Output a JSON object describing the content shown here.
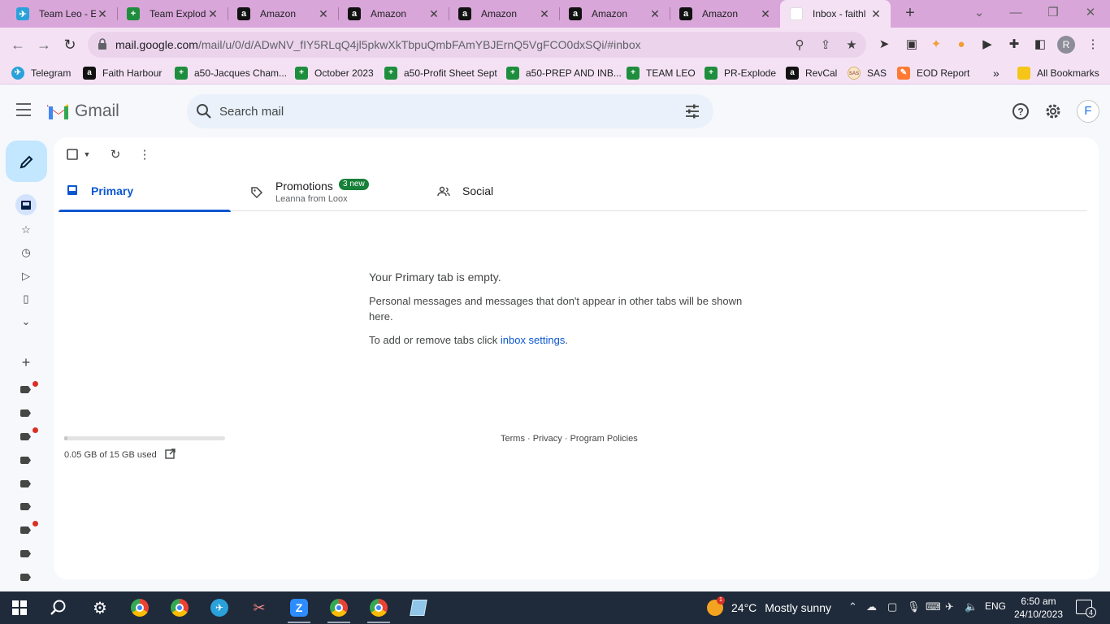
{
  "browser": {
    "tabs": [
      {
        "label": "Team Leo - E",
        "favicon": "telegram-icon"
      },
      {
        "label": "Team Explod",
        "favicon": "sheets-icon"
      },
      {
        "label": "Amazon",
        "favicon": "amazon-icon"
      },
      {
        "label": "Amazon",
        "favicon": "amazon-icon"
      },
      {
        "label": "Amazon",
        "favicon": "amazon-icon"
      },
      {
        "label": "Amazon",
        "favicon": "amazon-icon"
      },
      {
        "label": "Amazon",
        "favicon": "amazon-icon"
      },
      {
        "label": "Inbox - faithl",
        "favicon": "gmail-icon",
        "active": true
      }
    ],
    "url_host": "mail.google.com",
    "url_path": "/mail/u/0/d/ADwNV_fIY5RLqQ4jl5pkwXkTbpuQmbFAmYBJErnQ5VgFCO0dxSQi/#inbox",
    "profile_initial": "R",
    "bookmarks": [
      {
        "label": "Telegram",
        "icon": "telegram-icon"
      },
      {
        "label": "Faith Harbour",
        "icon": "amazon-icon"
      },
      {
        "label": "a50-Jacques Cham...",
        "icon": "sheets-icon"
      },
      {
        "label": "October 2023",
        "icon": "sheets-icon"
      },
      {
        "label": "a50-Profit Sheet Sept",
        "icon": "sheets-icon"
      },
      {
        "label": "a50-PREP AND INB...",
        "icon": "sheets-icon"
      },
      {
        "label": "TEAM LEO",
        "icon": "sheets-icon"
      },
      {
        "label": "PR-Explode",
        "icon": "sheets-icon"
      },
      {
        "label": "RevCal",
        "icon": "amazon-icon"
      },
      {
        "label": "SAS",
        "icon": "sas-icon"
      },
      {
        "label": "EOD Report",
        "icon": "eod-icon"
      }
    ],
    "more_bookmarks": "»",
    "all_bookmarks": "All Bookmarks",
    "colors": {
      "tabstrip": "#d9a6d9",
      "toolbar": "#f4e2f4"
    }
  },
  "gmail": {
    "product_name": "Gmail",
    "search_placeholder": "Search mail",
    "account_initial": "F",
    "tabs": [
      {
        "label": "Primary",
        "selected": true
      },
      {
        "label": "Promotions",
        "badge": "3 new",
        "subtext": "Leanna from Loox"
      },
      {
        "label": "Social"
      }
    ],
    "empty_state": {
      "title": "Your Primary tab is empty.",
      "body": "Personal messages and messages that don't appear in other tabs will be shown here.",
      "settings_prefix": "To add or remove tabs click ",
      "settings_link": "inbox settings",
      "settings_suffix": "."
    },
    "storage": {
      "text": "0.05 GB of 15 GB used",
      "fraction_used": 0.0033
    },
    "footer": {
      "terms": "Terms",
      "privacy": "Privacy",
      "policies": "Program Policies",
      "sep": " · "
    },
    "colors": {
      "accent": "#0b57d0",
      "compose_bg": "#c2e7ff",
      "badge": "#188038"
    }
  },
  "taskbar": {
    "weather_temp": "24°C",
    "weather_text": "Mostly sunny",
    "weather_badge": "1",
    "language": "ENG",
    "time": "6:50 am",
    "date": "24/10/2023",
    "notification_count": "4"
  }
}
